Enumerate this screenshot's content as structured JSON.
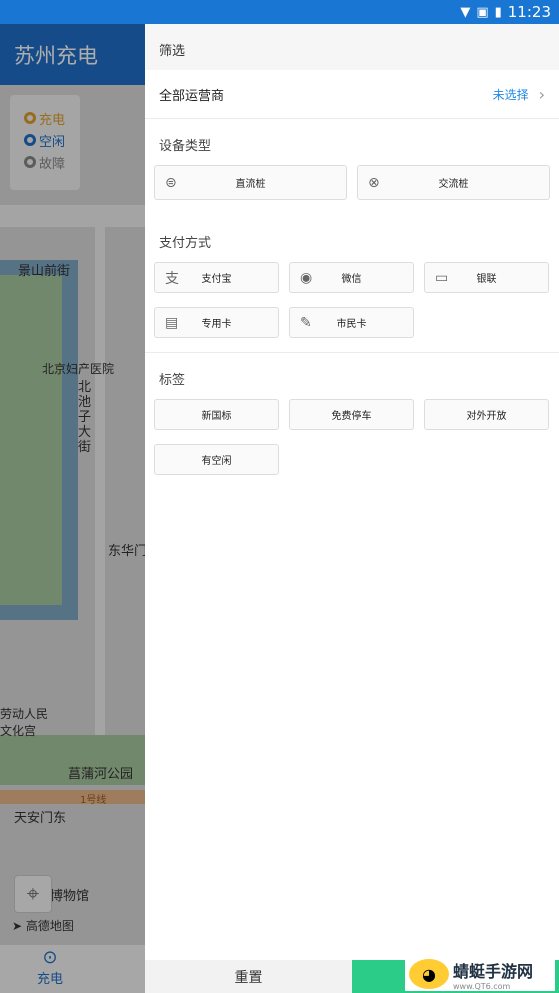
{
  "status_bar": {
    "time": "11:23"
  },
  "app": {
    "title": "苏州充电"
  },
  "map": {
    "legend": [
      {
        "label": "充电",
        "color": "#e0a030"
      },
      {
        "label": "空闲",
        "color": "#1e6fc9"
      },
      {
        "label": "故障",
        "color": "#888888"
      }
    ],
    "labels": {
      "jingshan": "景山前街",
      "hospital": "北京妇产医院",
      "beichizi": "北池子大街",
      "donghuamen": "东华门",
      "culture_palace": "劳动人民文化宫",
      "park": "菖蒲河公园",
      "tiananmen_east": "天安门东",
      "museum": "博物馆",
      "line1": "1号线"
    },
    "amap_logo": "高德地图"
  },
  "bottom_nav": {
    "charge_label": "充电"
  },
  "drawer": {
    "header": "筛选",
    "operator": {
      "label": "全部运营商",
      "value": "未选择"
    },
    "device_type": {
      "title": "设备类型",
      "options": [
        "直流桩",
        "交流桩"
      ]
    },
    "payment": {
      "title": "支付方式",
      "options": [
        "支付宝",
        "微信",
        "银联",
        "专用卡",
        "市民卡"
      ]
    },
    "tags": {
      "title": "标签",
      "options": [
        "新国标",
        "免费停车",
        "对外开放",
        "有空闲"
      ]
    },
    "reset_label": "重置"
  },
  "watermark": {
    "name": "蜻蜓手游网",
    "url": "www.QT6.com"
  }
}
